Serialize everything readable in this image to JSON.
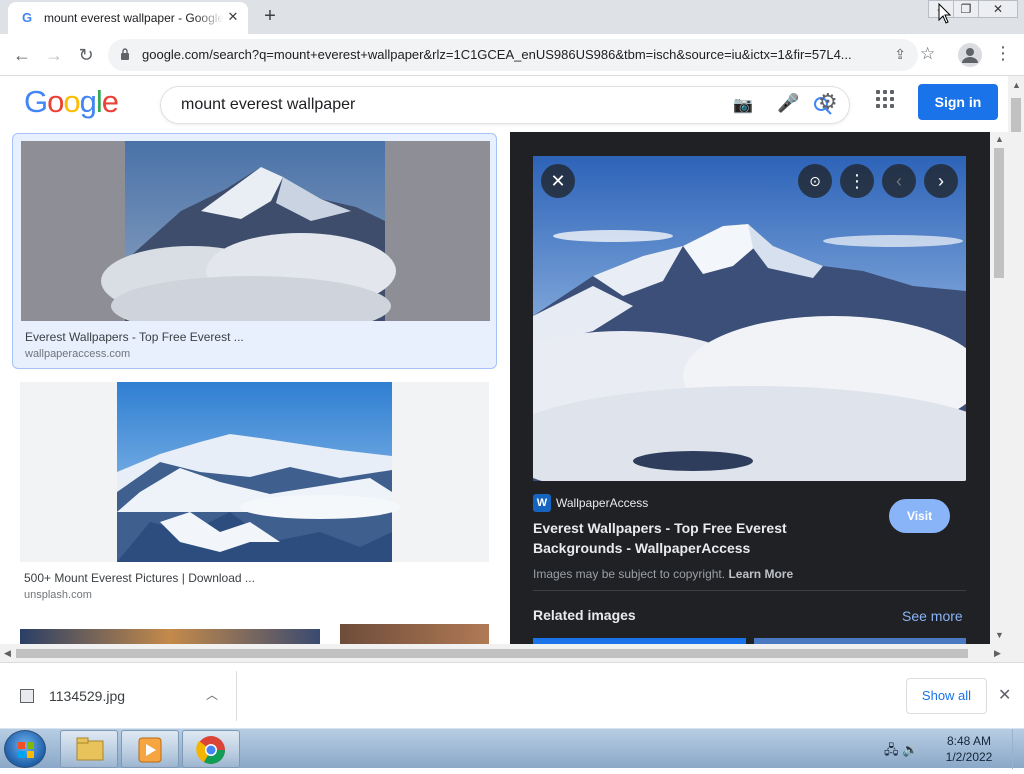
{
  "browser": {
    "tab_title": "mount everest wallpaper - Google Search",
    "tab_favicon": "G",
    "new_tab": "+",
    "url": "google.com/search?q=mount+everest+wallpaper&rlz=1C1GCEA_enUS986US986&tbm=isch&source=iu&ictx=1&fir=57L4...",
    "icons": [
      "back-icon",
      "forward-icon",
      "reload-icon",
      "lock-icon",
      "share-icon",
      "star-icon",
      "profile-icon",
      "kebab-menu-icon"
    ]
  },
  "google": {
    "logo": "Google",
    "query": "mount everest wallpaper",
    "signin": "Sign in",
    "brand_colors": [
      "#4285F4",
      "#EA4335",
      "#FBBC05",
      "#34A853"
    ]
  },
  "results": [
    {
      "title": "Everest Wallpapers - Top Free Everest ...",
      "source": "wallpaperaccess.com",
      "selected": true
    },
    {
      "title": "500+ Mount Everest Pictures | Download ...",
      "source": "unsplash.com",
      "selected": false
    }
  ],
  "panel": {
    "source_favicon": "W",
    "source_name": "WallpaperAccess",
    "title": "Everest Wallpapers - Top Free Everest Backgrounds - WallpaperAccess",
    "visit": "Visit",
    "copyright": "Images may be subject to copyright.",
    "learn_more": "Learn More",
    "related": "Related images",
    "see_more": "See more"
  },
  "downloads": {
    "file": "1134529.jpg",
    "show_all": "Show all"
  },
  "taskbar": {
    "time": "8:48 AM",
    "date": "1/2/2022"
  }
}
